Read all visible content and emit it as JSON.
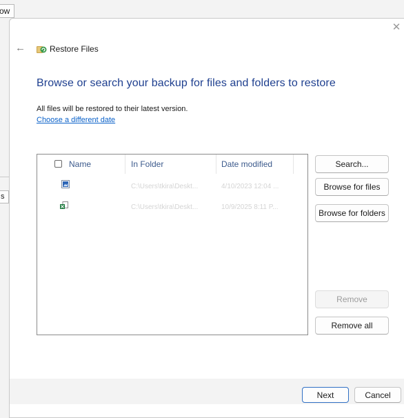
{
  "background": {
    "top_fragment": "ow",
    "side_fragment": "s"
  },
  "dialog": {
    "title": "Restore Files",
    "heading": "Browse or search your backup for files and folders to restore",
    "info": "All files will be restored to their latest version.",
    "link": "Choose a different date",
    "icons": [
      "back-arrow-icon",
      "restore-files-icon",
      "close-icon"
    ],
    "close_glyph": "✕",
    "back_glyph": "←"
  },
  "list": {
    "columns": {
      "name": "Name",
      "folder": "In Folder",
      "date": "Date modified"
    },
    "rows": [
      {
        "icon": "image-file-icon",
        "folder": "C:\\Users\\tkira\\Deskt...",
        "date": "4/10/2023 12:04 ..."
      },
      {
        "icon": "excel-file-icon",
        "folder": "C:\\Users\\tkira\\Deskt...",
        "date": "10/9/2025 8:11 P..."
      }
    ]
  },
  "buttons": {
    "search": "Search...",
    "browse_files": "Browse for files",
    "browse_folders": "Browse for folders",
    "remove": "Remove",
    "remove_all": "Remove all",
    "next": "Next",
    "cancel": "Cancel"
  },
  "colors": {
    "heading": "#1e3f8f",
    "link": "#0a61c9",
    "accent": "#2f6fc4"
  }
}
